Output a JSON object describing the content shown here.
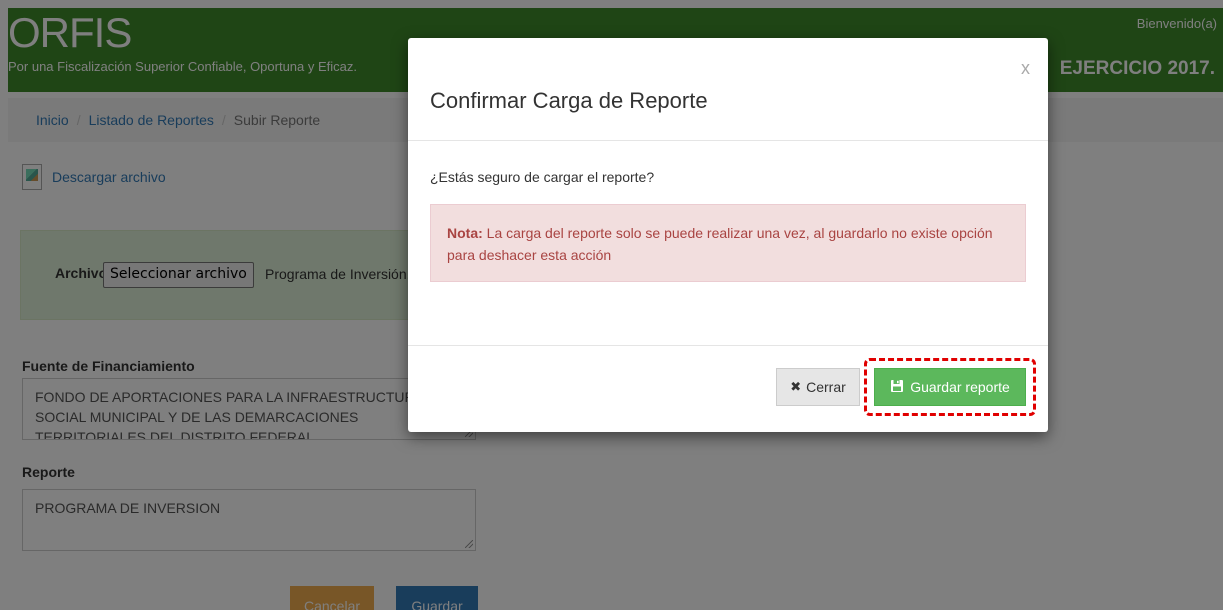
{
  "header": {
    "brand": "ORFIS",
    "tagline": "Por una Fiscalización Superior Confiable, Oportuna y Eficaz.",
    "welcome": "Bienvenido(a)",
    "ejercicio": "EJERCICIO 2017."
  },
  "breadcrumb": {
    "items": [
      "Inicio",
      "Listado de Reportes",
      "Subir Reporte"
    ],
    "separator": "/"
  },
  "download": {
    "label": "Descargar archivo",
    "icon": "broken-image-icon"
  },
  "upload": {
    "label": "Archivo",
    "button": "Seleccionar archivo",
    "file_name": "Programa de Inversión.p"
  },
  "form": {
    "fuente_label": "Fuente de Financiamiento",
    "fuente_value": "FONDO DE APORTACIONES PARA LA INFRAESTRUCTURA SOCIAL MUNICIPAL Y DE LAS DEMARCACIONES TERRITORIALES DEL DISTRITO FEDERAL",
    "reporte_label": "Reporte",
    "reporte_value": "PROGRAMA DE INVERSION",
    "cancel_button": "Cancelar",
    "save_button": "Guardar"
  },
  "modal": {
    "close": "x",
    "title": "Confirmar Carga de Reporte",
    "question": "¿Estás seguro de cargar el reporte?",
    "note_label": "Nota:",
    "note_text": " La carga del reporte solo se puede realizar una vez, al guardarlo no existe opción para deshacer esta acción",
    "close_button": "Cerrar",
    "close_icon": "✖",
    "save_button": "Guardar reporte",
    "save_icon": "floppy-icon"
  },
  "colors": {
    "header": "#3e8a2b",
    "success": "#5cb85c",
    "danger_bg": "#f2dede",
    "danger_text": "#a94442",
    "highlight": "#e00000",
    "warning": "#f0ad4e",
    "primary": "#337ab7"
  }
}
